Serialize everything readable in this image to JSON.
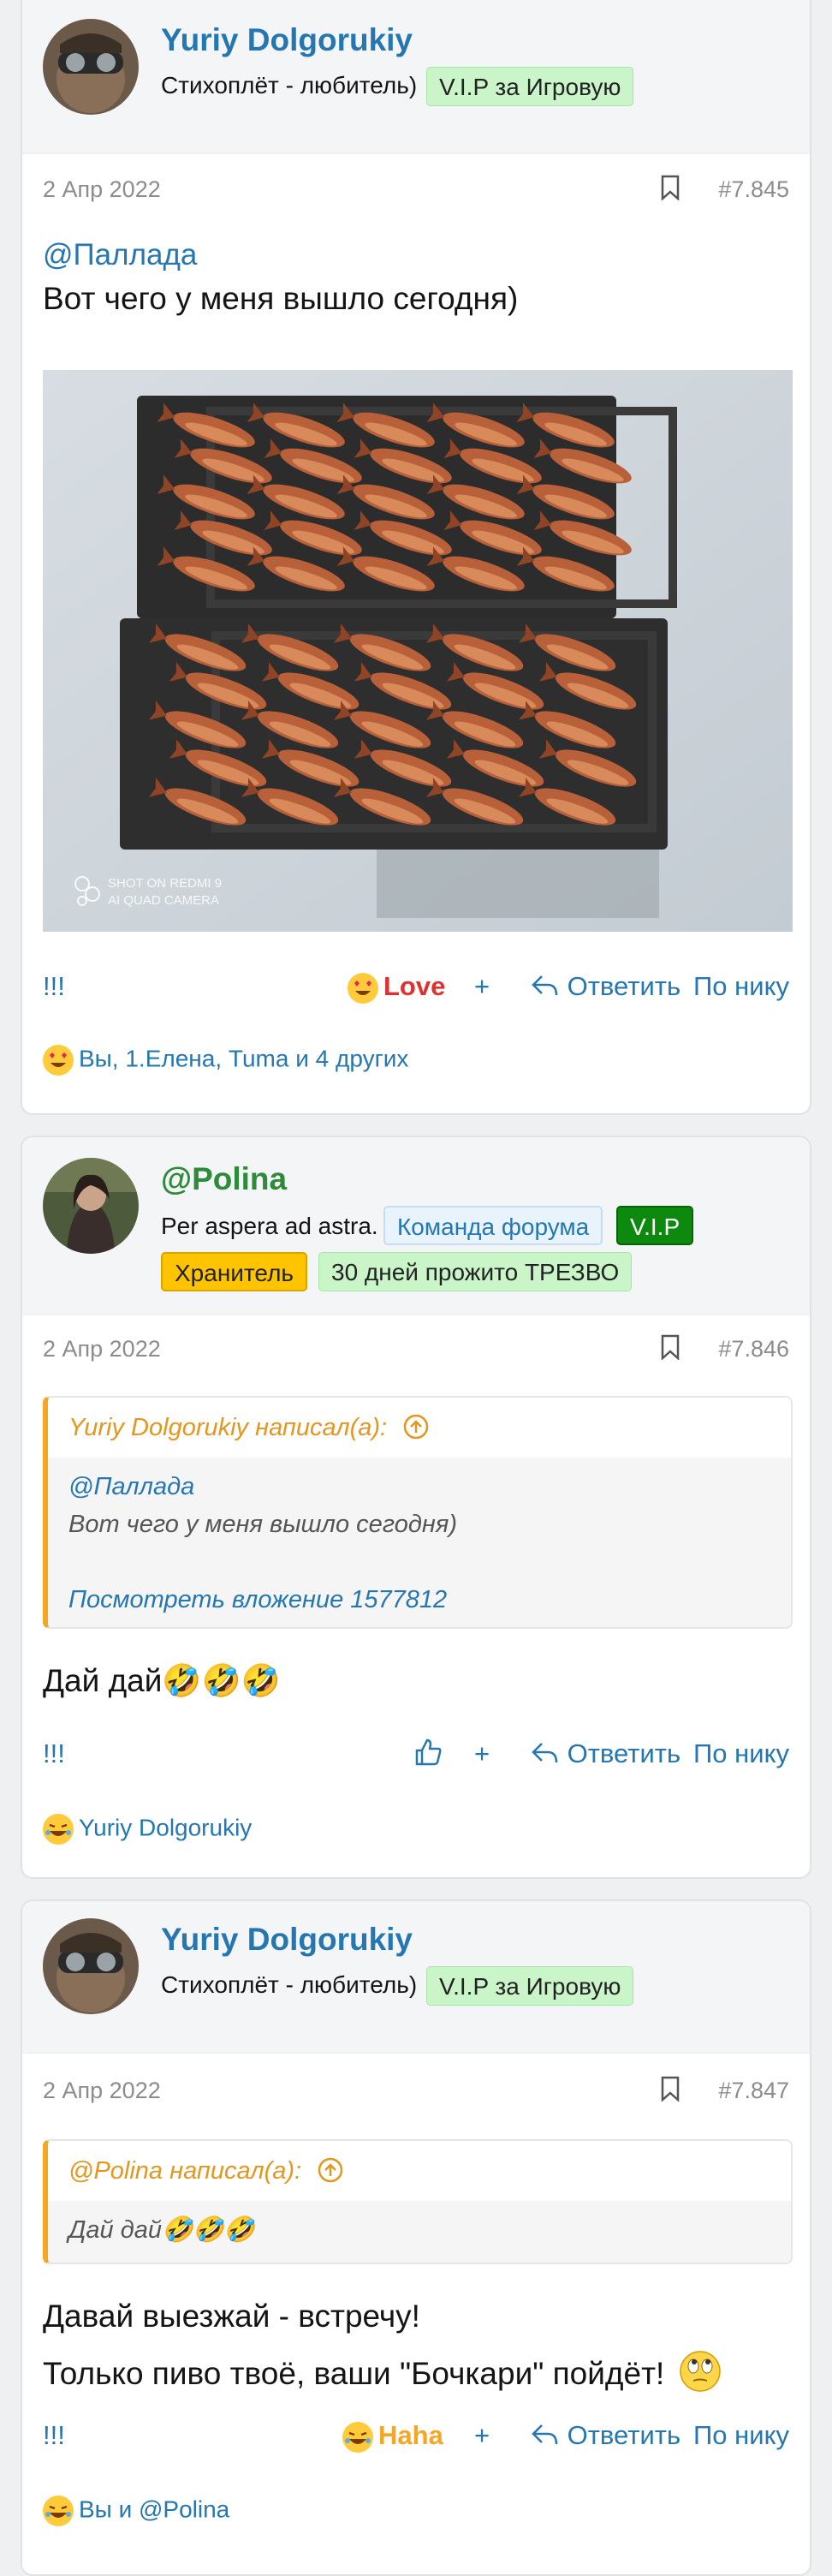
{
  "posts": [
    {
      "author": "Yuriy Dolgorukiy",
      "user_title": "Стихоплёт - любитель)",
      "badges": [
        "V.I.P за Игровую"
      ],
      "date": "2 Апр 2022",
      "number": "#7.845",
      "mention": "@Паллада",
      "text": "Вот чего у меня вышло сегодня)",
      "photo_watermark_1": "SHOT ON REDMI 9",
      "photo_watermark_2": "AI QUAD CAMERA",
      "actions": {
        "more": "!!!",
        "reaction": "Love",
        "add": "+",
        "reply": "Ответить",
        "by_nick": "По нику"
      },
      "reactions_text": "Вы, 1.Елена, Tuma и 4 других"
    },
    {
      "author": "@Polina",
      "user_title": "Per aspera ad astra.",
      "badges": [
        "Команда форума",
        "V.I.P",
        "Хранитель",
        "30 дней прожито ТРЕЗВО"
      ],
      "date": "2 Апр 2022",
      "number": "#7.846",
      "quote": {
        "header": "Yuriy Dolgorukiy написал(а):",
        "mention": "@Паллада",
        "text": "Вот чего у меня вышло сегодня)",
        "link": "Посмотреть вложение 1577812"
      },
      "text": "Дай дай🤣🤣🤣",
      "actions": {
        "more": "!!!",
        "add": "+",
        "reply": "Ответить",
        "by_nick": "По нику"
      },
      "reactions_text": "Yuriy Dolgorukiy"
    },
    {
      "author": "Yuriy Dolgorukiy",
      "user_title": "Стихоплёт - любитель)",
      "badges": [
        "V.I.P за Игровую"
      ],
      "date": "2 Апр 2022",
      "number": "#7.847",
      "quote": {
        "header": "@Polina написал(а):",
        "text": "Дай дай🤣🤣🤣"
      },
      "text_line1": "Давай выезжай - встречу!",
      "text_line2": "Только пиво твоё, ваши \"Бочкари\" пойдёт!",
      "actions": {
        "more": "!!!",
        "reaction": "Haha",
        "add": "+",
        "reply": "Ответить",
        "by_nick": "По нику"
      },
      "reactions_text": "Вы и @Polina"
    }
  ],
  "colors": {
    "link": "#2577b1",
    "love": "#e03131",
    "haha": "#f5a623",
    "vip": "#0d8a0d",
    "keeper": "#ffc400"
  }
}
